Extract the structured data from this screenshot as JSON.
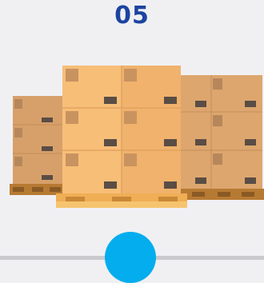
{
  "step": {
    "number": "05"
  },
  "illustration": {
    "icon": "pallet-of-boxes-icon"
  },
  "progress": {
    "icon": "slider-handle-icon"
  },
  "colors": {
    "accent": "#1b44a0",
    "handle": "#03adee",
    "track": "#c9c9ce",
    "box_front": "#f7be78",
    "box_side": "#dca46c",
    "pallet": "#f2b45c"
  }
}
